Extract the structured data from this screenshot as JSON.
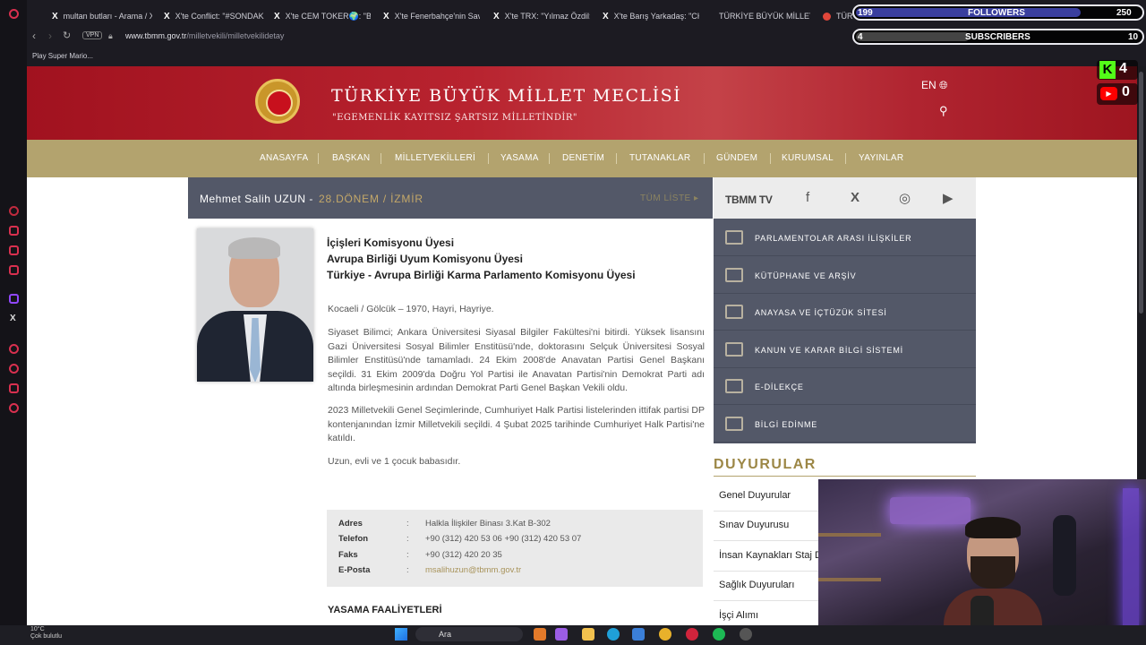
{
  "browser": {
    "tabs": [
      {
        "label": "multan butları - Arama / X",
        "icon": "x-icon"
      },
      {
        "label": "X'te Conflict: \"#SONDAK",
        "icon": "x-icon"
      },
      {
        "label": "X'te CEM TOKER🌍: \"Ba",
        "icon": "x-icon"
      },
      {
        "label": "X'te Fenerbahçe'nin Sav",
        "icon": "x-icon"
      },
      {
        "label": "X'te TRX: \"Yılmaz Özdil:",
        "icon": "x-icon"
      },
      {
        "label": "X'te Barış Yarkadaş: \"CH",
        "icon": "x-icon"
      },
      {
        "label": "TÜRKİYE BÜYÜK MİLLET",
        "icon": "tbmm-icon"
      },
      {
        "label": "TÜR",
        "icon": "tbmm-icon"
      }
    ],
    "vpn_label": "VPN",
    "url_domain": "www.tbmm.gov.tr",
    "url_path": "/milletvekili/milletvekilidetay",
    "bookmark": "Play Super Mario..."
  },
  "site": {
    "title": "TÜRKİYE BÜYÜK MİLLET MECLİSİ",
    "motto": "\"EGEMENLİK KAYITSIZ ŞARTSIZ MİLLETİNDİR\"",
    "lang": "EN",
    "menu": [
      "ANASAYFA",
      "BAŞKAN",
      "MİLLETVEKİLLERİ",
      "YASAMA",
      "DENETİM",
      "TUTANAKLAR",
      "GÜNDEM",
      "KURUMSAL",
      "YAYINLAR"
    ]
  },
  "member": {
    "name": "Mehmet Salih UZUN -",
    "term": "28.DÖNEM / İZMİR",
    "all_list": "TÜM LİSTE ▸",
    "roles": [
      "İçişleri Komisyonu Üyesi",
      "Avrupa Birliği Uyum Komisyonu Üyesi",
      "Türkiye - Avrupa Birliği Karma Parlamento Komisyonu Üyesi"
    ],
    "bio": [
      "Kocaeli / Gölcük – 1970, Hayri, Hayriye.",
      "Siyaset Bilimci; Ankara Üniversitesi Siyasal Bilgiler Fakültesi'ni bitirdi. Yüksek lisansını Gazi Üniversitesi Sosyal Bilimler Enstitüsü'nde, doktorasını Selçuk Üniversitesi Sosyal Bilimler Enstitüsü'nde tamamladı. 24 Ekim 2008'de Anavatan Partisi Genel Başkanı seçildi. 31 Ekim 2009'da Doğru Yol Partisi ile Anavatan Partisi'nin Demokrat Parti adı altında birleşmesinin ardından Demokrat Parti Genel Başkan Vekili oldu.",
      "2023 Milletvekili Genel Seçimlerinde, Cumhuriyet Halk Partisi listelerinden ittifak partisi DP kontenjanından İzmir Milletvekili seçildi. 4 Şubat 2025 tarihinde Cumhuriyet Halk Partisi'ne katıldı.",
      "Uzun, evli ve 1 çocuk babasıdır."
    ],
    "contact": [
      {
        "label": "Adres",
        "colon": ":",
        "value": "Halkla İlişkiler Binası 3.Kat B-302"
      },
      {
        "label": "Telefon",
        "colon": ":",
        "value": "+90 (312) 420 53 06 +90 (312) 420 53 07"
      },
      {
        "label": "Faks",
        "colon": ":",
        "value": "+90 (312) 420 20 35"
      },
      {
        "label": "E-Posta",
        "colon": ":",
        "value": "msalihuzun@tbmm.gov.tr"
      }
    ],
    "legislative_title": "YASAMA FAALİYETLERİ"
  },
  "right": {
    "tv_label": "TBMM TV",
    "socials": [
      "facebook-icon",
      "x-icon",
      "instagram-icon",
      "youtube-icon"
    ],
    "quick_links": [
      {
        "label": "PARLAMENTOLAR ARASI İLİŞKİLER",
        "icon": "handshake-icon"
      },
      {
        "label": "KÜTÜPHANE VE ARŞİV",
        "icon": "library-icon"
      },
      {
        "label": "ANAYASA VE İÇTÜZÜK SİTESİ",
        "icon": "document-icon"
      },
      {
        "label": "KANUN VE KARAR BİLGİ SİSTEMİ",
        "icon": "scales-icon"
      },
      {
        "label": "E-DİLEKÇE",
        "icon": "pen-icon"
      },
      {
        "label": "BİLGİ EDİNME",
        "icon": "magnifier-icon"
      }
    ],
    "announcements_title": "DUYURULAR",
    "announcements": [
      "Genel Duyurular",
      "Sınav Duyurusu",
      "İnsan Kaynakları Staj D",
      "Sağlık Duyuruları",
      "İşçi Alımı"
    ]
  },
  "overlay": {
    "followers_count": "199",
    "followers_label": "FOLLOWERS",
    "followers_goal": "250",
    "followers_progress": 0.79,
    "subscribers_count": "4",
    "subscribers_label": "SUBSCRIBERS",
    "subscribers_goal": "10",
    "subscribers_progress": 0.4,
    "kick_count": "4",
    "youtube_count": "0",
    "accent_green": "#53fc18",
    "accent_red": "#ff0000"
  },
  "taskbar": {
    "temperature": "10°C",
    "weather": "Çok bulutlu",
    "search_label": "Ara"
  }
}
